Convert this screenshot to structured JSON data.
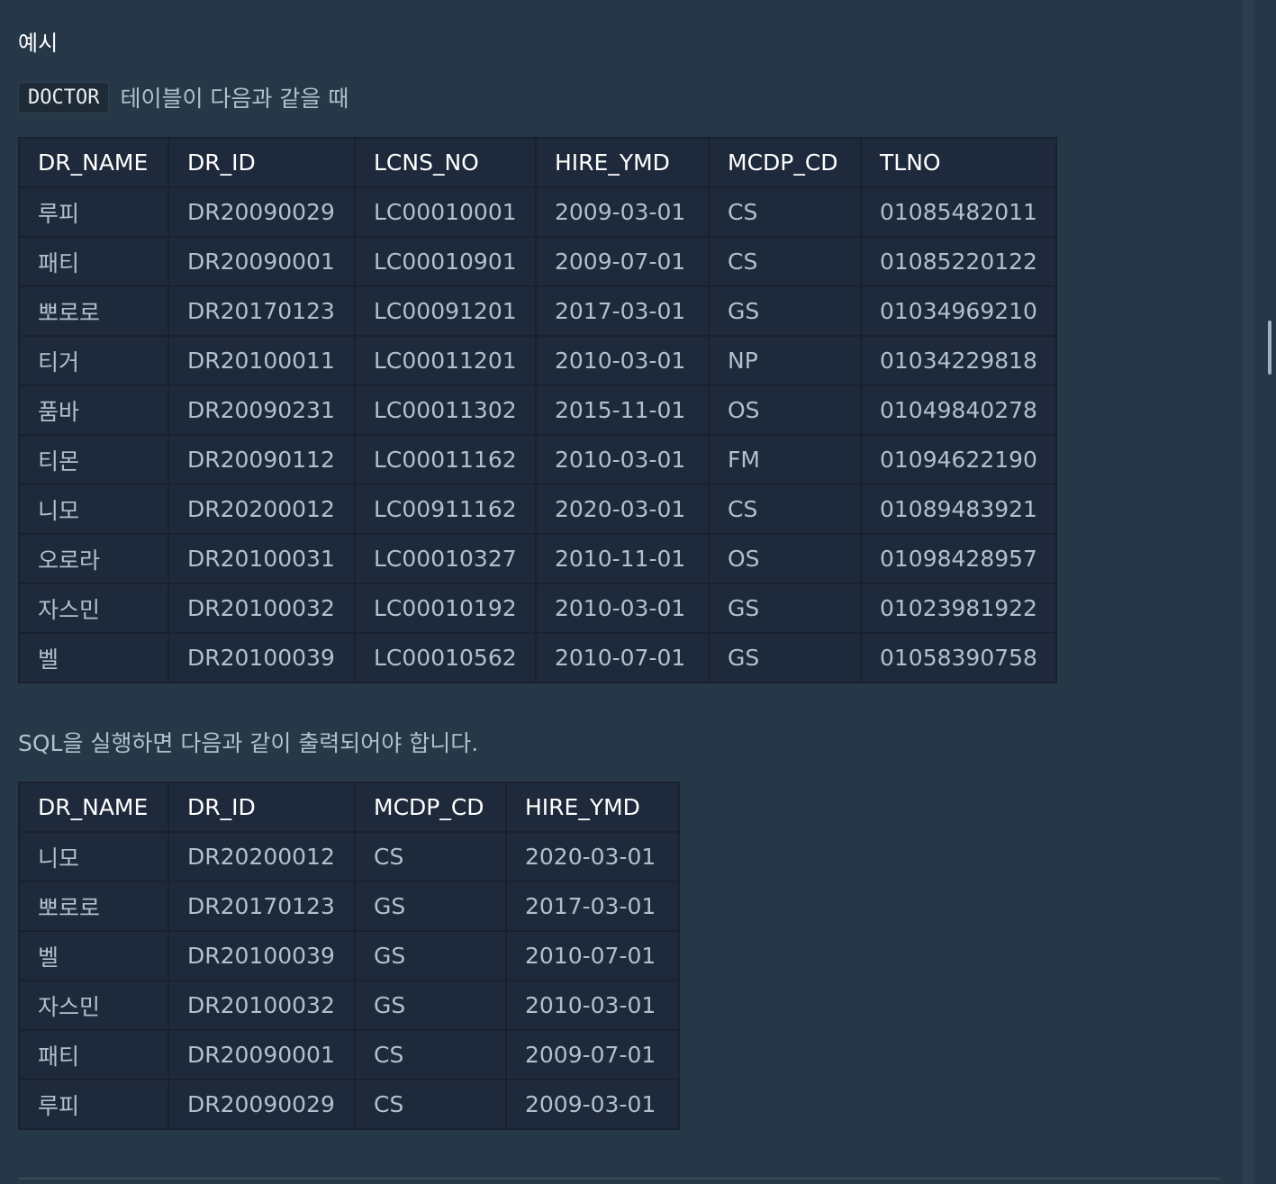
{
  "section_title": "예시",
  "intro": {
    "code": "DOCTOR",
    "text": "테이블이 다음과 같을 때"
  },
  "doctor_table": {
    "columns": [
      "DR_NAME",
      "DR_ID",
      "LCNS_NO",
      "HIRE_YMD",
      "MCDP_CD",
      "TLNO"
    ],
    "rows": [
      [
        "루피",
        "DR20090029",
        "LC00010001",
        "2009-03-01",
        "CS",
        "01085482011"
      ],
      [
        "패티",
        "DR20090001",
        "LC00010901",
        "2009-07-01",
        "CS",
        "01085220122"
      ],
      [
        "뽀로로",
        "DR20170123",
        "LC00091201",
        "2017-03-01",
        "GS",
        "01034969210"
      ],
      [
        "티거",
        "DR20100011",
        "LC00011201",
        "2010-03-01",
        "NP",
        "01034229818"
      ],
      [
        "품바",
        "DR20090231",
        "LC00011302",
        "2015-11-01",
        "OS",
        "01049840278"
      ],
      [
        "티몬",
        "DR20090112",
        "LC00011162",
        "2010-03-01",
        "FM",
        "01094622190"
      ],
      [
        "니모",
        "DR20200012",
        "LC00911162",
        "2020-03-01",
        "CS",
        "01089483921"
      ],
      [
        "오로라",
        "DR20100031",
        "LC00010327",
        "2010-11-01",
        "OS",
        "01098428957"
      ],
      [
        "자스민",
        "DR20100032",
        "LC00010192",
        "2010-03-01",
        "GS",
        "01023981922"
      ],
      [
        "벨",
        "DR20100039",
        "LC00010562",
        "2010-07-01",
        "GS",
        "01058390758"
      ]
    ]
  },
  "result_description": "SQL을 실행하면 다음과 같이 출력되어야 합니다.",
  "result_table": {
    "columns": [
      "DR_NAME",
      "DR_ID",
      "MCDP_CD",
      "HIRE_YMD"
    ],
    "rows": [
      [
        "니모",
        "DR20200012",
        "CS",
        "2020-03-01"
      ],
      [
        "뽀로로",
        "DR20170123",
        "GS",
        "2017-03-01"
      ],
      [
        "벨",
        "DR20100039",
        "GS",
        "2010-07-01"
      ],
      [
        "자스민",
        "DR20100032",
        "GS",
        "2010-03-01"
      ],
      [
        "패티",
        "DR20090001",
        "CS",
        "2009-07-01"
      ],
      [
        "루피",
        "DR20090029",
        "CS",
        "2009-03-01"
      ]
    ]
  }
}
